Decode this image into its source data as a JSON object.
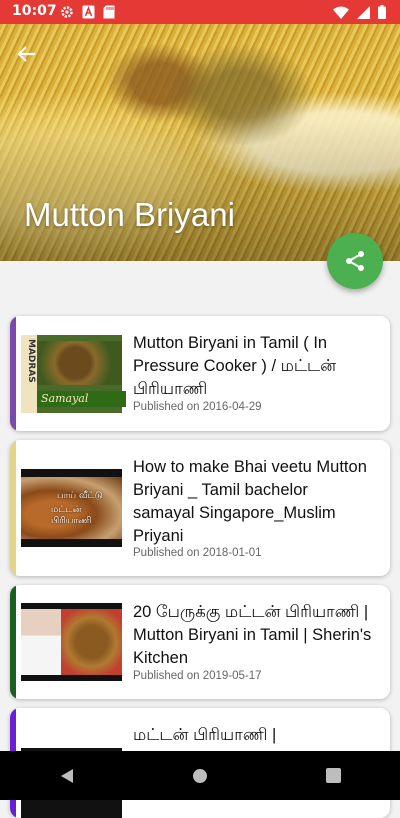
{
  "status": {
    "time": "10:07"
  },
  "header": {
    "title": "Mutton Briyani"
  },
  "videos": [
    {
      "title": "Mutton Biryani in Tamil ( In Pressure Cooker ) / மட்டன் பிரியாணி",
      "published": "Published on 2016-04-29",
      "accent": "#7b4aa8",
      "thumb_text_top": "MADRAS",
      "thumb_text_bottom": "Samayal"
    },
    {
      "title": "How to make Bhai veetu Mutton Briyani _ Tamil bachelor samayal Singapore_Muslim Priyani",
      "published": "Published on 2018-01-01",
      "accent": "#e0d58a",
      "thumb_text_top": "பாய் வீட்டு",
      "thumb_text_bottom": "மட்டன் பிரியாணி"
    },
    {
      "title": "20 பேருக்கு மட்டன் பிரியாணி | Mutton Biryani in Tamil | Sherin's Kitchen",
      "published": "Published on 2019-05-17",
      "accent": "#1b5e20"
    },
    {
      "title": "மட்டன் பிரியாணி |",
      "accent": "#6a1fd0"
    }
  ],
  "colors": {
    "status_bar": "#e53935",
    "fab": "#4caf50"
  },
  "icons": {
    "back": "back-arrow-icon",
    "share": "share-icon"
  }
}
